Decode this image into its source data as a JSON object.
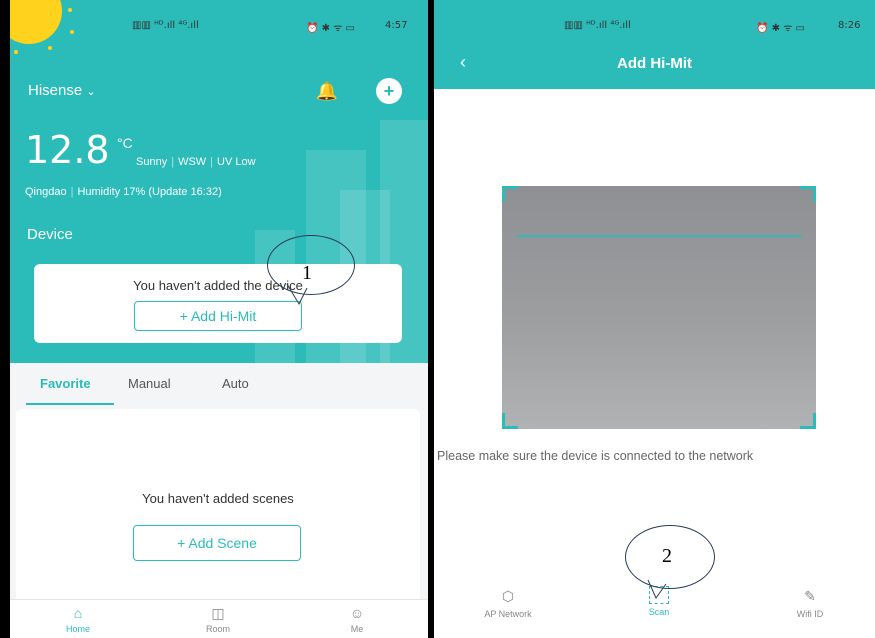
{
  "left": {
    "status": {
      "signal": "▥▥ ᴴᴰ.ıll ⁴ᴳ.ıll",
      "icons": "⏰ ✱ ᯤ ▭",
      "time": "4:57"
    },
    "location_selector": "Hisense",
    "weather": {
      "temperature": "12.8",
      "unit": "°C",
      "condition": "Sunny",
      "wind": "WSW",
      "uv": "UV Low",
      "city": "Qingdao",
      "humidity": "Humidity 17%",
      "update": "(Update 16:32)"
    },
    "device_section_title": "Device",
    "device_empty_text": "You haven't added the device",
    "add_device_button": "+   Add Hi-Mit",
    "tabs": [
      "Favorite",
      "Manual",
      "Auto"
    ],
    "scene_empty_text": "You haven't added scenes",
    "add_scene_button": "+   Add Scene",
    "nav": [
      {
        "label": "Home",
        "icon": "home-icon"
      },
      {
        "label": "Room",
        "icon": "room-icon"
      },
      {
        "label": "Me",
        "icon": "profile-icon"
      }
    ]
  },
  "right": {
    "status": {
      "signal": "▥▥ ᴴᴰ.ıll ⁴ᴳ.ıll",
      "icons": "⏰ ✱ ᯤ ▭",
      "time": "8:26"
    },
    "title": "Add Hi-Mit",
    "hint": "Please make sure the device is connected to the network",
    "nav": [
      {
        "label": "AP Network",
        "icon": "ap-network-icon"
      },
      {
        "label": "Scan",
        "icon": "scan-icon"
      },
      {
        "label": "Wifi ID",
        "icon": "wifi-id-icon"
      }
    ]
  },
  "callouts": [
    "1",
    "2"
  ],
  "colors": {
    "accent": "#2bbcb9",
    "sun": "#ffd21e"
  }
}
